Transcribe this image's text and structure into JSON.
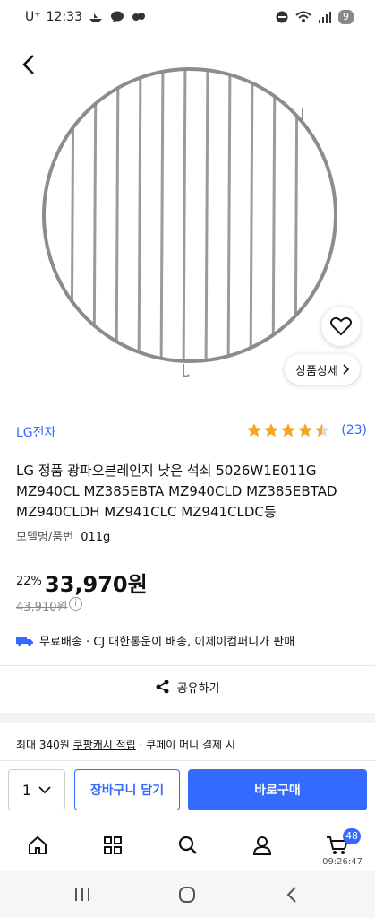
{
  "status_bar": {
    "carrier": "U⁺",
    "time": "12:33",
    "battery": "9"
  },
  "product": {
    "brand": "LG전자",
    "rating_count": "(23)",
    "rating": 4.5,
    "title": "LG 정품 광파오븐레인지 낮은 석쇠 5026W1E011G MZ940CL MZ385EBTA MZ940CLD MZ385EBTAD MZ940CLDH MZ941CLC MZ941CLDC등",
    "model_label": "모델명/품번",
    "model_value": "011g",
    "discount": "22%",
    "price": "33,970원",
    "original_price": "43,910원",
    "delivery": "무료배송 · CJ 대한통운이 배송, 이제이컴퍼니가 판매",
    "detail_button": "상품상세",
    "share_label": "공유하기"
  },
  "promo": {
    "prefix": "최대 340원 ",
    "link": "쿠팡캐시 적립",
    "suffix": " · 쿠페이 머니 결제 시"
  },
  "purchase": {
    "quantity": "1",
    "cart_button": "장바구니 담기",
    "buy_button": "바로구매"
  },
  "nav": {
    "cart_badge": "48",
    "clock": "09:26:47"
  },
  "colors": {
    "accent": "#346aff",
    "star": "#f5a623"
  }
}
